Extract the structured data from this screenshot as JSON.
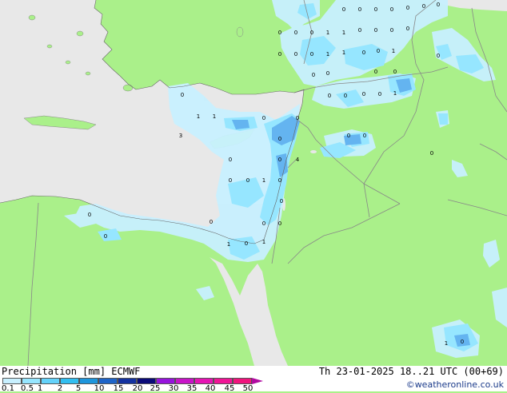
{
  "header": {
    "title": "Precipitation [mm]",
    "model": "ECMWF",
    "valid_time": "Th 23-01-2025 18..21 UTC (00+69)",
    "credit": "©weatheronline.co.uk"
  },
  "legend": {
    "ticks": [
      "0.1",
      "0.5",
      "1",
      "2",
      "5",
      "10",
      "15",
      "20",
      "25",
      "30",
      "35",
      "40",
      "45",
      "50"
    ],
    "colors": [
      "#ffffff",
      "#c8f0ff",
      "#96e6ff",
      "#64d2fa",
      "#32bef0",
      "#1e96dc",
      "#1e64c8",
      "#1432a0",
      "#0a0a78",
      "#9614dc",
      "#c814c8",
      "#e614b4",
      "#f01496",
      "#f0147d"
    ]
  },
  "map_colors": {
    "land": "#aaf08a",
    "sea": "#e8e8e8",
    "light_precip": "#c8f0ff",
    "mod_precip": "#96e6ff",
    "heavy_precip": "#64b4f0",
    "border": "#888888"
  },
  "values": [
    "0",
    "0",
    "0",
    "0",
    "0",
    "0",
    "0",
    "0",
    "0",
    "0",
    "1",
    "1",
    "0",
    "0",
    "0",
    "0",
    "0",
    "0",
    "0",
    "1",
    "1",
    "0",
    "0",
    "1",
    "0",
    "0",
    "0",
    "0",
    "0",
    "0",
    "0",
    "0",
    "0",
    "1",
    "0",
    "1",
    "1",
    "0",
    "0",
    "0",
    "3",
    "0",
    "0",
    "4",
    "0",
    "0",
    "1",
    "0",
    "0",
    "0",
    "0",
    "0",
    "0",
    "1",
    "0",
    "1",
    "0",
    "0",
    "0",
    "0",
    "1",
    "0"
  ]
}
